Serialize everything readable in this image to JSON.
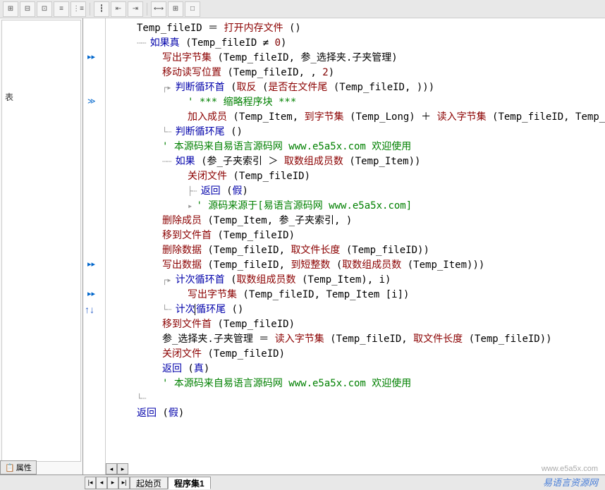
{
  "toolbar": {
    "buttons": [
      "⊞",
      "⊟",
      "⊡",
      "≡",
      "⋮≡",
      "┇",
      "⇤",
      "⇥",
      "",
      "⟷",
      "⊞",
      "□"
    ]
  },
  "left_panel": {
    "property_tab": "属性",
    "tree_text": "表"
  },
  "code": {
    "lines": [
      {
        "indent": 1,
        "segments": [
          {
            "t": "var",
            "v": "Temp_fileID"
          },
          {
            "t": "op",
            "v": " ＝ "
          },
          {
            "t": "fn",
            "v": "打开内存文件"
          },
          {
            "t": "p",
            "v": " ()"
          }
        ]
      },
      {
        "indent": 1,
        "prefix": "┄┄",
        "segments": [
          {
            "t": "kw",
            "v": "如果真"
          },
          {
            "t": "p",
            "v": " ("
          },
          {
            "t": "var",
            "v": "Temp_fileID"
          },
          {
            "t": "op",
            "v": " ≠ "
          },
          {
            "t": "num",
            "v": "0"
          },
          {
            "t": "p",
            "v": ")"
          }
        ]
      },
      {
        "indent": 2,
        "marker": "▸▸",
        "segments": [
          {
            "t": "fn",
            "v": "写出字节集"
          },
          {
            "t": "p",
            "v": " ("
          },
          {
            "t": "var",
            "v": "Temp_fileID"
          },
          {
            "t": "p",
            "v": ", "
          },
          {
            "t": "var",
            "v": "参_选择夹.子夹管理"
          },
          {
            "t": "p",
            "v": ")"
          }
        ]
      },
      {
        "indent": 2,
        "segments": [
          {
            "t": "fn",
            "v": "移动读写位置"
          },
          {
            "t": "p",
            "v": " ("
          },
          {
            "t": "var",
            "v": "Temp_fileID"
          },
          {
            "t": "p",
            "v": ", , "
          },
          {
            "t": "num",
            "v": "2"
          },
          {
            "t": "p",
            "v": ")"
          }
        ]
      },
      {
        "indent": 2,
        "prefix": "┌▸",
        "segments": [
          {
            "t": "kw",
            "v": "判断循环首"
          },
          {
            "t": "p",
            "v": " ("
          },
          {
            "t": "fn",
            "v": "取反"
          },
          {
            "t": "p",
            "v": " ("
          },
          {
            "t": "fn",
            "v": "是否在文件尾"
          },
          {
            "t": "p",
            "v": " ("
          },
          {
            "t": "var",
            "v": "Temp_fileID"
          },
          {
            "t": "p",
            "v": ", )))"
          }
        ]
      },
      {
        "indent": 3,
        "marker": "≫",
        "segments": [
          {
            "t": "cm",
            "v": "'  *** 缩略程序块 ***"
          }
        ]
      },
      {
        "indent": 3,
        "segments": [
          {
            "t": "fn",
            "v": "加入成员"
          },
          {
            "t": "p",
            "v": " ("
          },
          {
            "t": "var",
            "v": "Temp_Item"
          },
          {
            "t": "p",
            "v": ", "
          },
          {
            "t": "fn",
            "v": "到字节集"
          },
          {
            "t": "p",
            "v": " ("
          },
          {
            "t": "var",
            "v": "Temp_Long"
          },
          {
            "t": "p",
            "v": ") ＋ "
          },
          {
            "t": "fn",
            "v": "读入字节集"
          },
          {
            "t": "p",
            "v": " ("
          },
          {
            "t": "var",
            "v": "Temp_fileID"
          },
          {
            "t": "p",
            "v": ", "
          },
          {
            "t": "var",
            "v": "Temp_Long"
          },
          {
            "t": "p",
            "v": "))"
          }
        ]
      },
      {
        "indent": 2,
        "prefix": "└┄",
        "segments": [
          {
            "t": "kw",
            "v": "判断循环尾"
          },
          {
            "t": "p",
            "v": " ()"
          }
        ]
      },
      {
        "indent": 2,
        "segments": [
          {
            "t": "cm",
            "v": "' 本源码来自易语言源码网 www.e5a5x.com  欢迎使用"
          }
        ]
      },
      {
        "indent": 2,
        "prefix": "┄┄",
        "segments": [
          {
            "t": "kw",
            "v": "如果"
          },
          {
            "t": "p",
            "v": " ("
          },
          {
            "t": "var",
            "v": "参_子夹索引"
          },
          {
            "t": "op",
            "v": " ＞ "
          },
          {
            "t": "fn",
            "v": "取数组成员数"
          },
          {
            "t": "p",
            "v": " ("
          },
          {
            "t": "var",
            "v": "Temp_Item"
          },
          {
            "t": "p",
            "v": "))"
          }
        ]
      },
      {
        "indent": 3,
        "segments": [
          {
            "t": "fn",
            "v": "关闭文件"
          },
          {
            "t": "p",
            "v": " ("
          },
          {
            "t": "var",
            "v": "Temp_fileID"
          },
          {
            "t": "p",
            "v": ")"
          }
        ]
      },
      {
        "indent": 3,
        "prefix": "├┄",
        "segments": [
          {
            "t": "kw",
            "v": "返回"
          },
          {
            "t": "p",
            "v": " ("
          },
          {
            "t": "kw",
            "v": "假"
          },
          {
            "t": "p",
            "v": ")"
          }
        ]
      },
      {
        "indent": 3,
        "prefix": "▸",
        "segments": [
          {
            "t": "cm",
            "v": "' 源码来源于[易语言源码网 www.e5a5x.com]"
          }
        ]
      },
      {
        "indent": 2,
        "segments": [
          {
            "t": "fn",
            "v": "删除成员"
          },
          {
            "t": "p",
            "v": " ("
          },
          {
            "t": "var",
            "v": "Temp_Item"
          },
          {
            "t": "p",
            "v": ", "
          },
          {
            "t": "var",
            "v": "参_子夹索引"
          },
          {
            "t": "p",
            "v": ", )"
          }
        ]
      },
      {
        "indent": 2,
        "segments": [
          {
            "t": "fn",
            "v": "移到文件首"
          },
          {
            "t": "p",
            "v": " ("
          },
          {
            "t": "var",
            "v": "Temp_fileID"
          },
          {
            "t": "p",
            "v": ")"
          }
        ]
      },
      {
        "indent": 2,
        "segments": [
          {
            "t": "fn",
            "v": "删除数据"
          },
          {
            "t": "p",
            "v": " ("
          },
          {
            "t": "var",
            "v": "Temp_fileID"
          },
          {
            "t": "p",
            "v": ", "
          },
          {
            "t": "fn",
            "v": "取文件长度"
          },
          {
            "t": "p",
            "v": " ("
          },
          {
            "t": "var",
            "v": "Temp_fileID"
          },
          {
            "t": "p",
            "v": "))"
          }
        ]
      },
      {
        "indent": 2,
        "marker": "▸▸",
        "segments": [
          {
            "t": "fn",
            "v": "写出数据"
          },
          {
            "t": "p",
            "v": " ("
          },
          {
            "t": "var",
            "v": "Temp_fileID"
          },
          {
            "t": "p",
            "v": ", "
          },
          {
            "t": "fn",
            "v": "到短整数"
          },
          {
            "t": "p",
            "v": " ("
          },
          {
            "t": "fn",
            "v": "取数组成员数"
          },
          {
            "t": "p",
            "v": " ("
          },
          {
            "t": "var",
            "v": "Temp_Item"
          },
          {
            "t": "p",
            "v": ")))"
          }
        ]
      },
      {
        "indent": 2,
        "prefix": "┌▸",
        "segments": [
          {
            "t": "kw",
            "v": "计次循环首"
          },
          {
            "t": "p",
            "v": " ("
          },
          {
            "t": "fn",
            "v": "取数组成员数"
          },
          {
            "t": "p",
            "v": " ("
          },
          {
            "t": "var",
            "v": "Temp_Item"
          },
          {
            "t": "p",
            "v": "), "
          },
          {
            "t": "var",
            "v": "i"
          },
          {
            "t": "p",
            "v": ")"
          }
        ]
      },
      {
        "indent": 3,
        "marker": "▸▸",
        "segments": [
          {
            "t": "fn",
            "v": "写出字节集"
          },
          {
            "t": "p",
            "v": " ("
          },
          {
            "t": "var",
            "v": "Temp_fileID"
          },
          {
            "t": "p",
            "v": ", "
          },
          {
            "t": "var",
            "v": "Temp_Item"
          },
          {
            "t": "p",
            "v": " ["
          },
          {
            "t": "var",
            "v": "i"
          },
          {
            "t": "p",
            "v": "])"
          }
        ]
      },
      {
        "indent": 2,
        "marker": "↑↓",
        "prefix": "└┄",
        "segments": [
          {
            "t": "kw",
            "v": "计次"
          },
          {
            "t": "caret",
            "v": ""
          },
          {
            "t": "kw",
            "v": "循环尾"
          },
          {
            "t": "p",
            "v": " ()"
          }
        ]
      },
      {
        "indent": 2,
        "segments": [
          {
            "t": "fn",
            "v": "移到文件首"
          },
          {
            "t": "p",
            "v": " ("
          },
          {
            "t": "var",
            "v": "Temp_fileID"
          },
          {
            "t": "p",
            "v": ")"
          }
        ]
      },
      {
        "indent": 2,
        "segments": [
          {
            "t": "var",
            "v": "参_选择夹.子夹管理"
          },
          {
            "t": "op",
            "v": " ＝ "
          },
          {
            "t": "fn",
            "v": "读入字节集"
          },
          {
            "t": "p",
            "v": " ("
          },
          {
            "t": "var",
            "v": "Temp_fileID"
          },
          {
            "t": "p",
            "v": ", "
          },
          {
            "t": "fn",
            "v": "取文件长度"
          },
          {
            "t": "p",
            "v": " ("
          },
          {
            "t": "var",
            "v": "Temp_fileID"
          },
          {
            "t": "p",
            "v": "))"
          }
        ]
      },
      {
        "indent": 2,
        "segments": [
          {
            "t": "fn",
            "v": "关闭文件"
          },
          {
            "t": "p",
            "v": " ("
          },
          {
            "t": "var",
            "v": "Temp_fileID"
          },
          {
            "t": "p",
            "v": ")"
          }
        ]
      },
      {
        "indent": 2,
        "segments": [
          {
            "t": "kw",
            "v": "返回"
          },
          {
            "t": "p",
            "v": " ("
          },
          {
            "t": "kw",
            "v": "真"
          },
          {
            "t": "p",
            "v": ")"
          }
        ]
      },
      {
        "indent": 2,
        "segments": [
          {
            "t": "cm",
            "v": "' 本源码来自易语言源码网 www.e5a5x.com  欢迎使用"
          }
        ]
      },
      {
        "indent": 1,
        "prefix": "└┄",
        "segments": []
      },
      {
        "indent": 1,
        "segments": [
          {
            "t": "kw",
            "v": "返回"
          },
          {
            "t": "p",
            "v": " ("
          },
          {
            "t": "kw",
            "v": "假"
          },
          {
            "t": "p",
            "v": ")"
          }
        ]
      }
    ]
  },
  "tabs": {
    "start": "起始页",
    "module": "程序集1"
  },
  "watermark": {
    "text": "易语言资源网",
    "url": "www.e5a5x.com"
  }
}
